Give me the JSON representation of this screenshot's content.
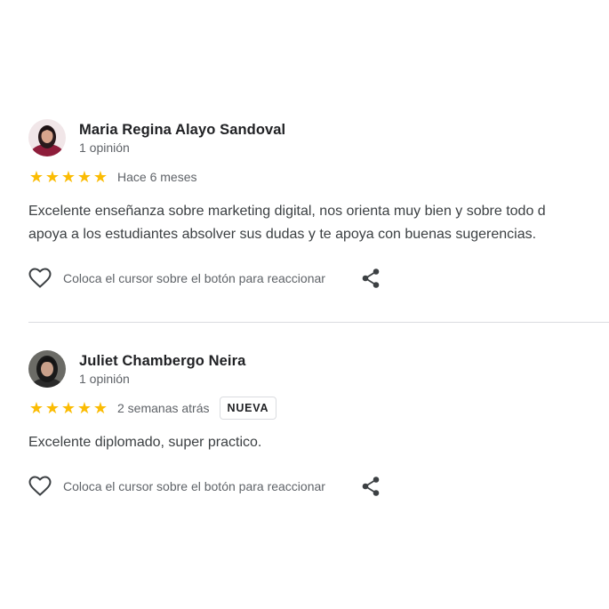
{
  "reviews": [
    {
      "author": "Maria Regina Alayo Sandoval",
      "count": "1 opinión",
      "rating": 5,
      "date": "Hace 6 meses",
      "badge": "",
      "text_lines": [
        "Excelente enseñanza sobre marketing digital, nos orienta muy bien y sobre todo d",
        "apoya a los estudiantes absolver sus dudas y te apoya con buenas sugerencias."
      ],
      "react_label": "Coloca el cursor sobre el botón para reaccionar"
    },
    {
      "author": "Juliet Chambergo Neira",
      "count": "1 opinión",
      "rating": 5,
      "date": "2 semanas atrás",
      "badge": "NUEVA",
      "text_lines": [
        "Excelente diplomado, super practico."
      ],
      "react_label": "Coloca el cursor sobre el botón para reaccionar"
    }
  ],
  "icons": {
    "star": "star-icon",
    "heart": "heart-icon",
    "share": "share-icon"
  },
  "colors": {
    "star": "#fbbc04",
    "name": "#202124",
    "secondary": "#5f6368",
    "body": "#3c4043",
    "divider": "#dadce0"
  }
}
